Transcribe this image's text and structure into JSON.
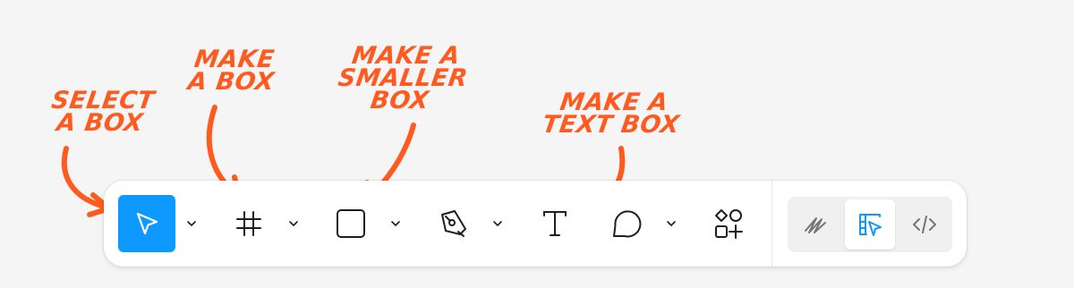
{
  "colors": {
    "accent": "#0d99ff",
    "annotation": "#ff5a1f",
    "icon": "#1e1e1e",
    "mode_icon": "#757575"
  },
  "annotations": [
    {
      "id": "select",
      "text": "SELECT\nA BOX"
    },
    {
      "id": "frame",
      "text": "MAKE\nA BOX"
    },
    {
      "id": "rect",
      "text": "MAKE A\nSMALLER\nBOX"
    },
    {
      "id": "text",
      "text": "MAKE A\nTEXT BOX"
    }
  ],
  "toolbar": {
    "tools": [
      {
        "name": "move-tool",
        "icon": "cursor-arrow-icon",
        "active": true,
        "has_dropdown": true
      },
      {
        "name": "frame-tool",
        "icon": "frame-hash-icon",
        "active": false,
        "has_dropdown": true
      },
      {
        "name": "rectangle-tool",
        "icon": "rounded-square-icon",
        "active": false,
        "has_dropdown": true
      },
      {
        "name": "pen-tool",
        "icon": "pen-nib-icon",
        "active": false,
        "has_dropdown": true
      },
      {
        "name": "text-tool",
        "icon": "text-t-icon",
        "active": false,
        "has_dropdown": false
      },
      {
        "name": "comment-tool",
        "icon": "speech-bubble-icon",
        "active": false,
        "has_dropdown": true
      },
      {
        "name": "resources-tool",
        "icon": "shapes-plus-icon",
        "active": false,
        "has_dropdown": false
      }
    ],
    "modes": [
      {
        "name": "draw-mode",
        "icon": "scribble-icon",
        "active": false
      },
      {
        "name": "design-mode",
        "icon": "design-cursor-icon",
        "active": true
      },
      {
        "name": "dev-mode",
        "icon": "code-brackets-icon",
        "active": false
      }
    ]
  }
}
